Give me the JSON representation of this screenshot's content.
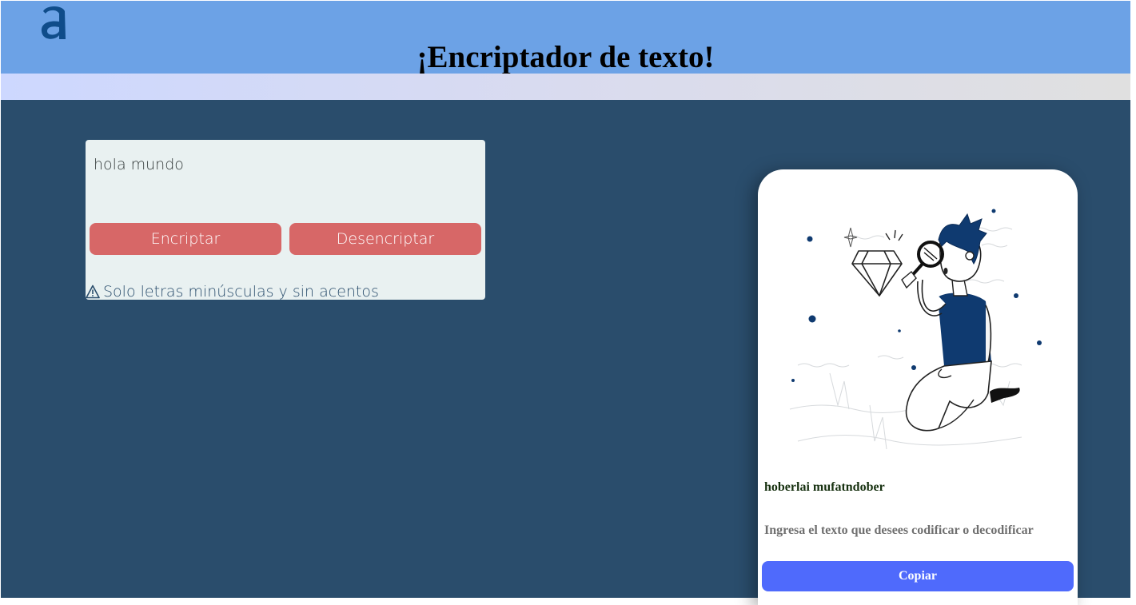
{
  "header": {
    "logo_icon": "alura-logo-icon",
    "title": "¡Encriptador de texto!"
  },
  "input_panel": {
    "text_value": "hola mundo",
    "encrypt_label": "Encriptar",
    "decrypt_label": "Desencriptar",
    "notice_icon": "warning-icon",
    "notice_text": "Solo letras minúsculas y sin acentos"
  },
  "output_card": {
    "illustration": "person-with-magnifying-glass-illustration",
    "result_text": "hoberlai mufatndober",
    "hint_text": "Ingresa el texto que desees codificar o decodificar",
    "copy_label": "Copiar"
  },
  "colors": {
    "header_bg": "#6ca2e6",
    "main_bg": "#2a4d6c",
    "button_red": "#d76767",
    "button_blue": "#4f6afc",
    "panel_bg": "#e9f1f1",
    "logo_blue": "#0f4c8a"
  }
}
